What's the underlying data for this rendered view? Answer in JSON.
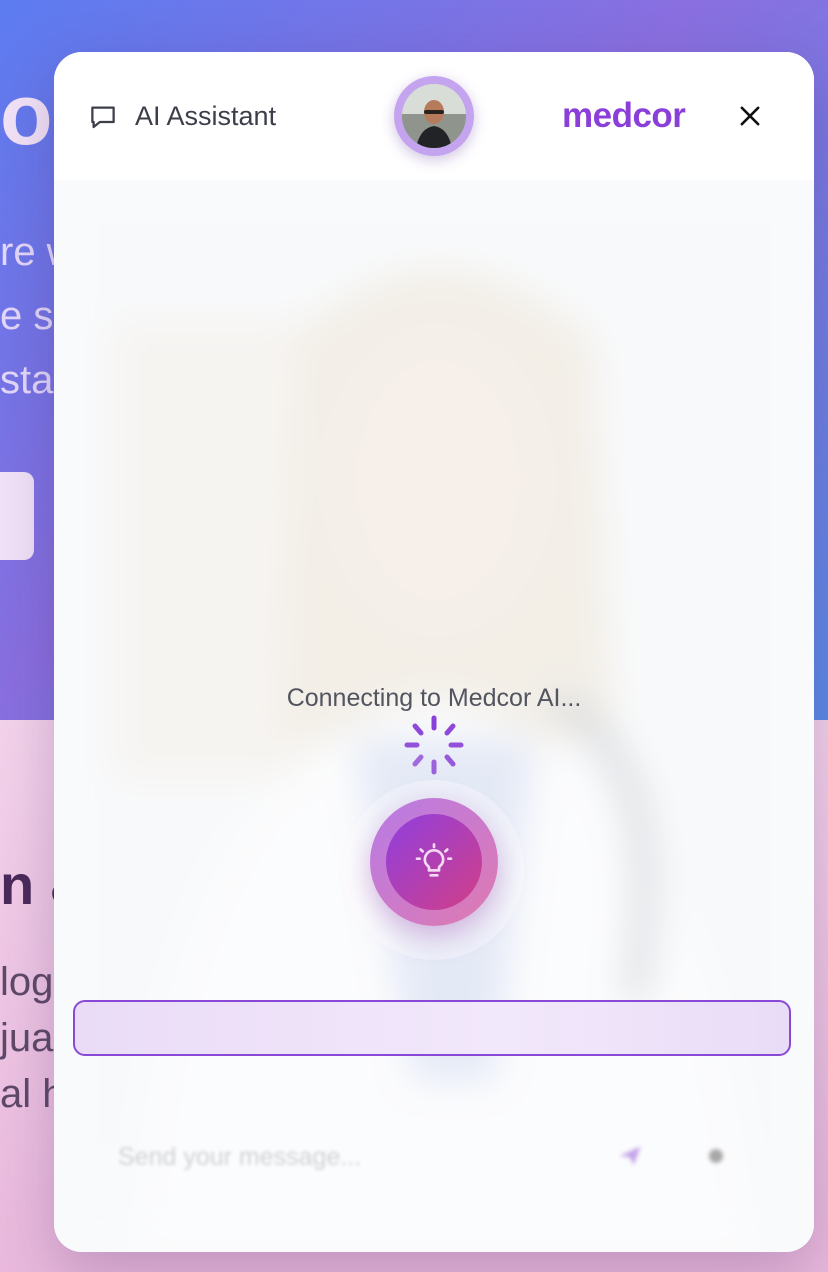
{
  "background": {
    "hero_heading_fragment": "o",
    "hero_lines": [
      "re w",
      "e s",
      "sta"
    ],
    "section_heading_fragment": "n &",
    "section_lines": [
      "log",
      "juag",
      "al h"
    ]
  },
  "header": {
    "title": "AI Assistant",
    "logo": "medcor",
    "close_icon": "close-icon",
    "chat_icon": "chat-bubble-icon"
  },
  "body": {
    "status": "Connecting to Medcor AI...",
    "mic_icon": "lightbulb-icon",
    "input_placeholder": "Send your message...",
    "transcript": ""
  },
  "colors": {
    "brand": "#8b3fd9",
    "accent_gradient_start": "#8f3fe0",
    "accent_gradient_end": "#d23f86"
  }
}
